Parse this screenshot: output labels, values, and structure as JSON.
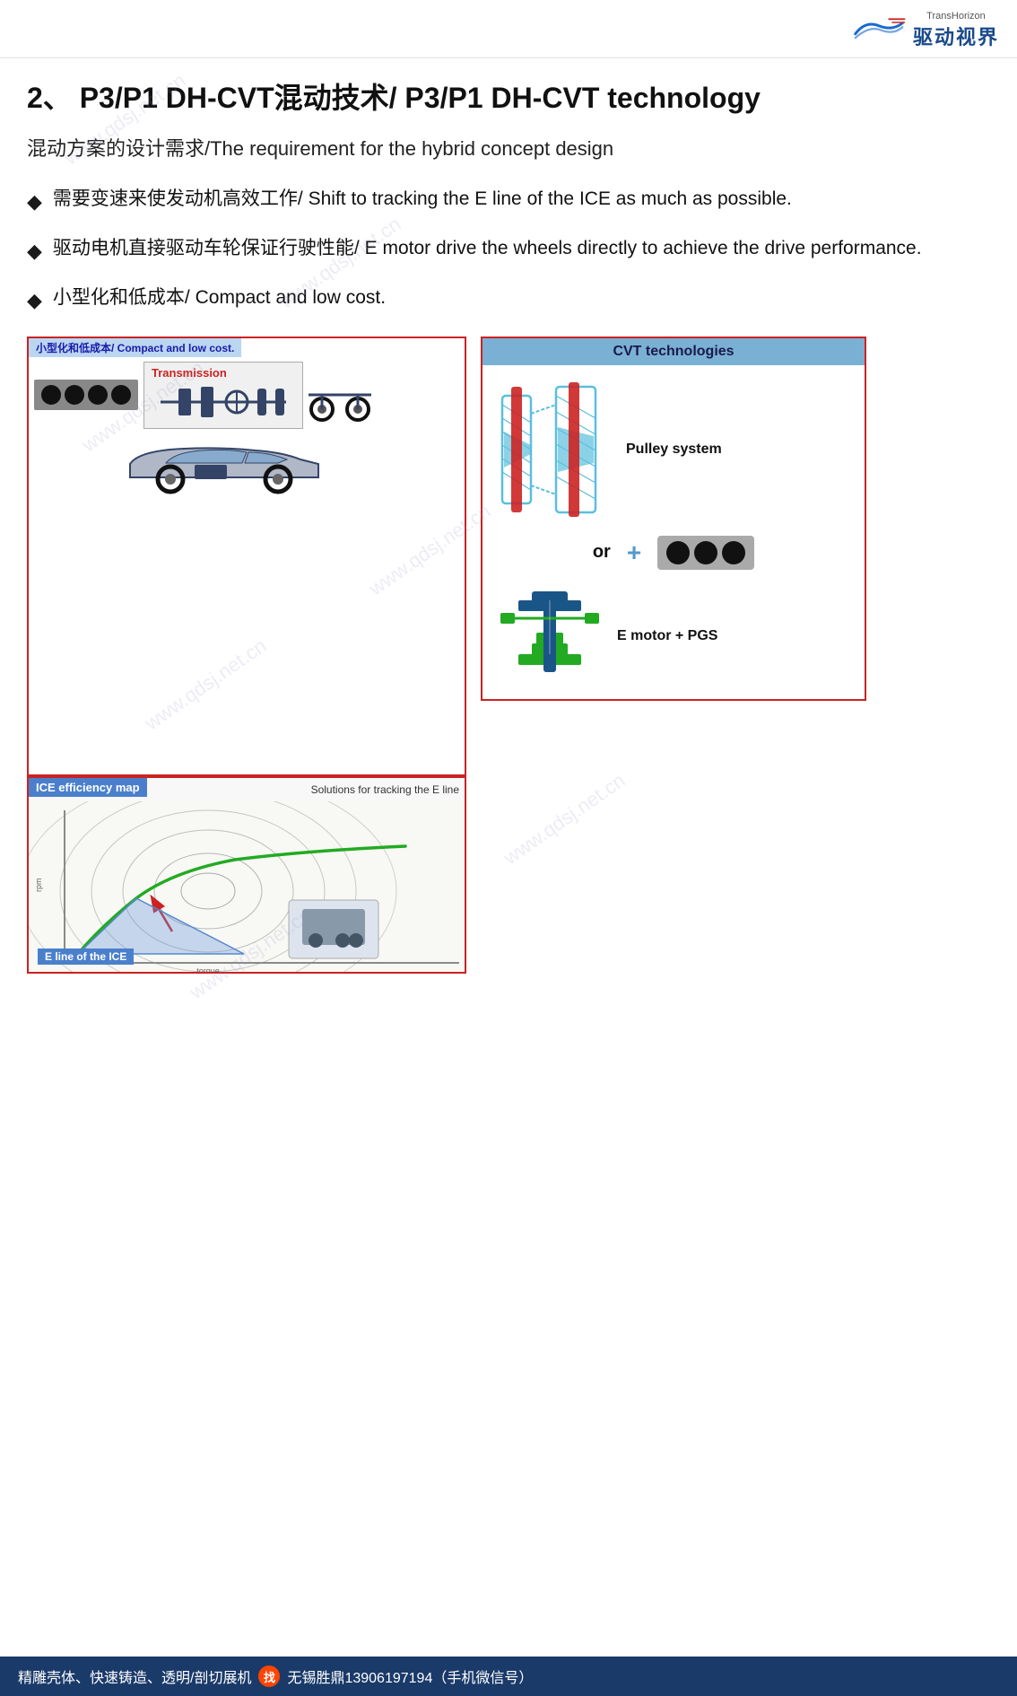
{
  "header": {
    "logo_text_cn": "驱动视界",
    "logo_text_en": "TransHorizon"
  },
  "title": {
    "number": "2、",
    "main": "P3/P1 DH-CVT混动技术/ P3/P1 DH-CVT technology"
  },
  "subtitle": "混动方案的设计需求/The requirement for the hybrid concept design",
  "bullets": [
    {
      "cn": "需要变速来使发动机高效工作/",
      "en": "Shift to tracking the E line of the ICE as much as possible."
    },
    {
      "cn": "驱动电机直接驱动车轮保证行驶性能/",
      "en": "E motor drive the wheels directly to achieve the drive performance."
    },
    {
      "cn": "小型化和低成本/",
      "en": "Compact and low cost."
    }
  ],
  "diagrams": {
    "left_top_label": "小型化和低成本/ Compact and low cost.",
    "transmission_label": "Transmission",
    "ice_map_title": "ICE efficiency map",
    "e_line_label": "E line of  the ICE",
    "solutions_label": "Solutions for tracking the E line",
    "cvt_title": "CVT technologies",
    "pulley_label": "Pulley system",
    "or_text": "or",
    "emorot_label": "E motor + PGS"
  },
  "footer": {
    "text_left": "精雕壳体、快速铸造、透明/剖切展机",
    "highlight_char": "找",
    "text_right": "无锡胜鼎13906197194（手机微信号）"
  },
  "watermark": {
    "lines": [
      "www.qdsj.net.cn",
      "www.qdsj.net.cn",
      "www.qdsj.net.cn",
      "www.qdsj.net.cn",
      "www.qdsj.net.cn",
      "www.qdsj.net.cn"
    ]
  }
}
